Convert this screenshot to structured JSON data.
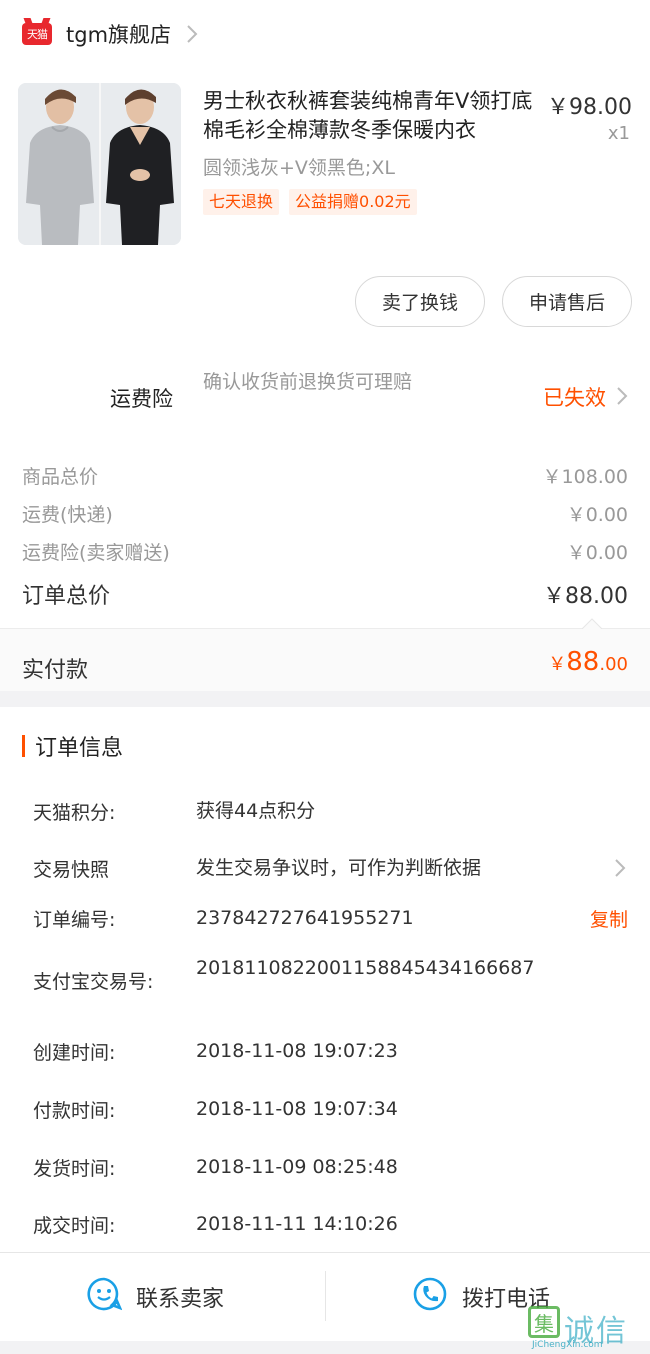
{
  "store": {
    "logo_text": "天猫",
    "name": "tgm旗舰店"
  },
  "product": {
    "title": "男士秋衣秋裤套装纯棉青年V领打底棉毛衫全棉薄款冬季保暖内衣",
    "price": "￥98.00",
    "quantity": "x1",
    "sku": "圆领浅灰+V领黑色;XL",
    "tags": [
      "七天退换",
      "公益捐赠0.02元"
    ]
  },
  "actions": {
    "sell_button": "卖了换钱",
    "after_sale_button": "申请售后"
  },
  "insurance": {
    "label": "运费险",
    "description": "确认收货前退换货可理赔",
    "status": "已失效"
  },
  "summary": {
    "rows": [
      {
        "label": "商品总价",
        "value": "￥108.00"
      },
      {
        "label": "运费(快递)",
        "value": "￥0.00"
      },
      {
        "label": "运费险(卖家赠送)",
        "value": "￥0.00"
      }
    ],
    "total_label": "订单总价",
    "total_value": "￥88.00"
  },
  "paid": {
    "label": "实付款",
    "currency": "￥",
    "integer": "88",
    "decimal": ".00"
  },
  "order_info": {
    "title": "订单信息",
    "points_label": "天猫积分:",
    "points_value": "获得44点积分",
    "snapshot_label": "交易快照",
    "snapshot_value": "发生交易争议时，可作为判断依据",
    "order_no_label": "订单编号:",
    "order_no_value": "237842727641955271",
    "copy_label": "复制",
    "alipay_label": "支付宝交易号:",
    "alipay_value": "2018110822001158845434166687",
    "created_label": "创建时间:",
    "created_value": "2018-11-08 19:07:23",
    "paid_label": "付款时间:",
    "paid_value": "2018-11-08 19:07:34",
    "shipped_label": "发货时间:",
    "shipped_value": "2018-11-09 08:25:48",
    "completed_label": "成交时间:",
    "completed_value": "2018-11-11 14:10:26"
  },
  "bottom": {
    "contact_seller": "联系卖家",
    "call_phone": "拨打电话"
  },
  "watermark": {
    "mark": "集",
    "text": "诚信",
    "url": "JiChengXin.com"
  },
  "colors": {
    "accent": "#ff5000",
    "tmall_red": "#e8282e",
    "icon_blue": "#1aa0e6"
  },
  "icons": [
    "tmall-logo-icon",
    "chevron-right-icon",
    "chat-bubble-icon",
    "phone-icon"
  ]
}
